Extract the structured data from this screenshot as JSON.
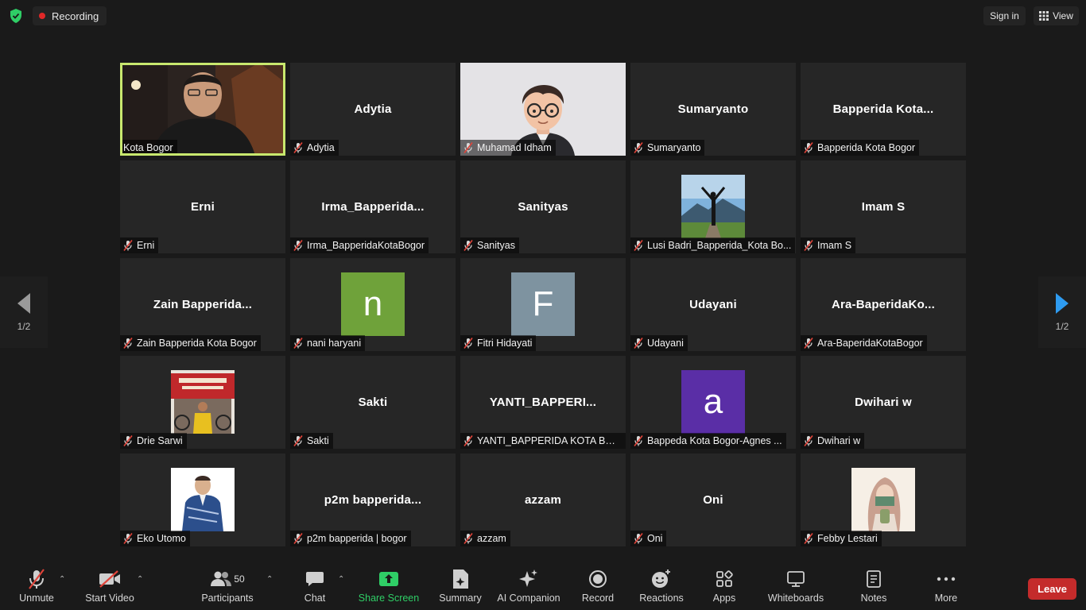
{
  "top": {
    "recording_label": "Recording",
    "signin_label": "Sign in",
    "view_label": "View"
  },
  "pager": {
    "page": "1/2"
  },
  "tiles": [
    {
      "name": "",
      "label": "Kota Bogor",
      "kind": "video",
      "active": true,
      "muted": false
    },
    {
      "name": "Adytia",
      "label": "Adytia",
      "kind": "name",
      "muted": true
    },
    {
      "name": "",
      "label": "Muhamad Idham",
      "kind": "avatar",
      "muted": true
    },
    {
      "name": "Sumaryanto",
      "label": "Sumaryanto",
      "kind": "name",
      "muted": true
    },
    {
      "name": "Bapperida  Kota...",
      "label": "Bapperida Kota Bogor",
      "kind": "name",
      "muted": true
    },
    {
      "name": "Erni",
      "label": "Erni",
      "kind": "name",
      "muted": true
    },
    {
      "name": "Irma_Bapperida...",
      "label": "Irma_BapperidaKotaBogor",
      "kind": "name",
      "muted": true
    },
    {
      "name": "Sanityas",
      "label": "Sanityas",
      "kind": "name",
      "muted": true
    },
    {
      "name": "",
      "label": "Lusi Badri_Bapperida_Kota Bo...",
      "kind": "photo-mountain",
      "muted": true
    },
    {
      "name": "Imam S",
      "label": "Imam S",
      "kind": "name",
      "muted": true
    },
    {
      "name": "Zain  Bapperida...",
      "label": "Zain Bapperida Kota Bogor",
      "kind": "name",
      "muted": true
    },
    {
      "name": "",
      "label": "nani haryani",
      "kind": "letter",
      "letter": "n",
      "color": "#6fa23a",
      "muted": true
    },
    {
      "name": "",
      "label": "Fitri Hidayati",
      "kind": "letter",
      "letter": "F",
      "color": "#7e93a0",
      "muted": true
    },
    {
      "name": "Udayani",
      "label": "Udayani",
      "kind": "name",
      "muted": true
    },
    {
      "name": "Ara-BaperidaKo...",
      "label": "Ara-BaperidaKotaBogor",
      "kind": "name",
      "muted": true
    },
    {
      "name": "",
      "label": "Drie Sarwi",
      "kind": "photo-event",
      "muted": true
    },
    {
      "name": "Sakti",
      "label": "Sakti",
      "kind": "name",
      "muted": true
    },
    {
      "name": "YANTI_BAPPERI...",
      "label": "YANTI_BAPPERIDA KOTA BOG...",
      "kind": "name",
      "muted": true
    },
    {
      "name": "",
      "label": "Bappeda Kota Bogor-Agnes ...",
      "kind": "letter",
      "letter": "a",
      "color": "#5a2ea6",
      "muted": true
    },
    {
      "name": "Dwihari w",
      "label": "Dwihari w",
      "kind": "name",
      "muted": true
    },
    {
      "name": "",
      "label": "Eko Utomo",
      "kind": "photo-man",
      "muted": true
    },
    {
      "name": "p2m  bapperida...",
      "label": "p2m bapperida | bogor",
      "kind": "name",
      "muted": true
    },
    {
      "name": "azzam",
      "label": "azzam",
      "kind": "name",
      "muted": true
    },
    {
      "name": "Oni",
      "label": "Oni",
      "kind": "name",
      "muted": true
    },
    {
      "name": "",
      "label": "Febby Lestari",
      "kind": "photo-hijab",
      "muted": true
    }
  ],
  "toolbar": {
    "unmute": "Unmute",
    "start_video": "Start Video",
    "participants": "Participants",
    "participants_count": "50",
    "chat": "Chat",
    "share_screen": "Share Screen",
    "summary": "Summary",
    "ai_companion": "AI Companion",
    "record": "Record",
    "reactions": "Reactions",
    "apps": "Apps",
    "whiteboards": "Whiteboards",
    "notes": "Notes",
    "more": "More",
    "leave": "Leave"
  },
  "colors": {
    "accent_green": "#2fce66",
    "leave_red": "#c42b2b",
    "active_border": "#c8e86e",
    "nav_blue": "#2e9bf0"
  }
}
